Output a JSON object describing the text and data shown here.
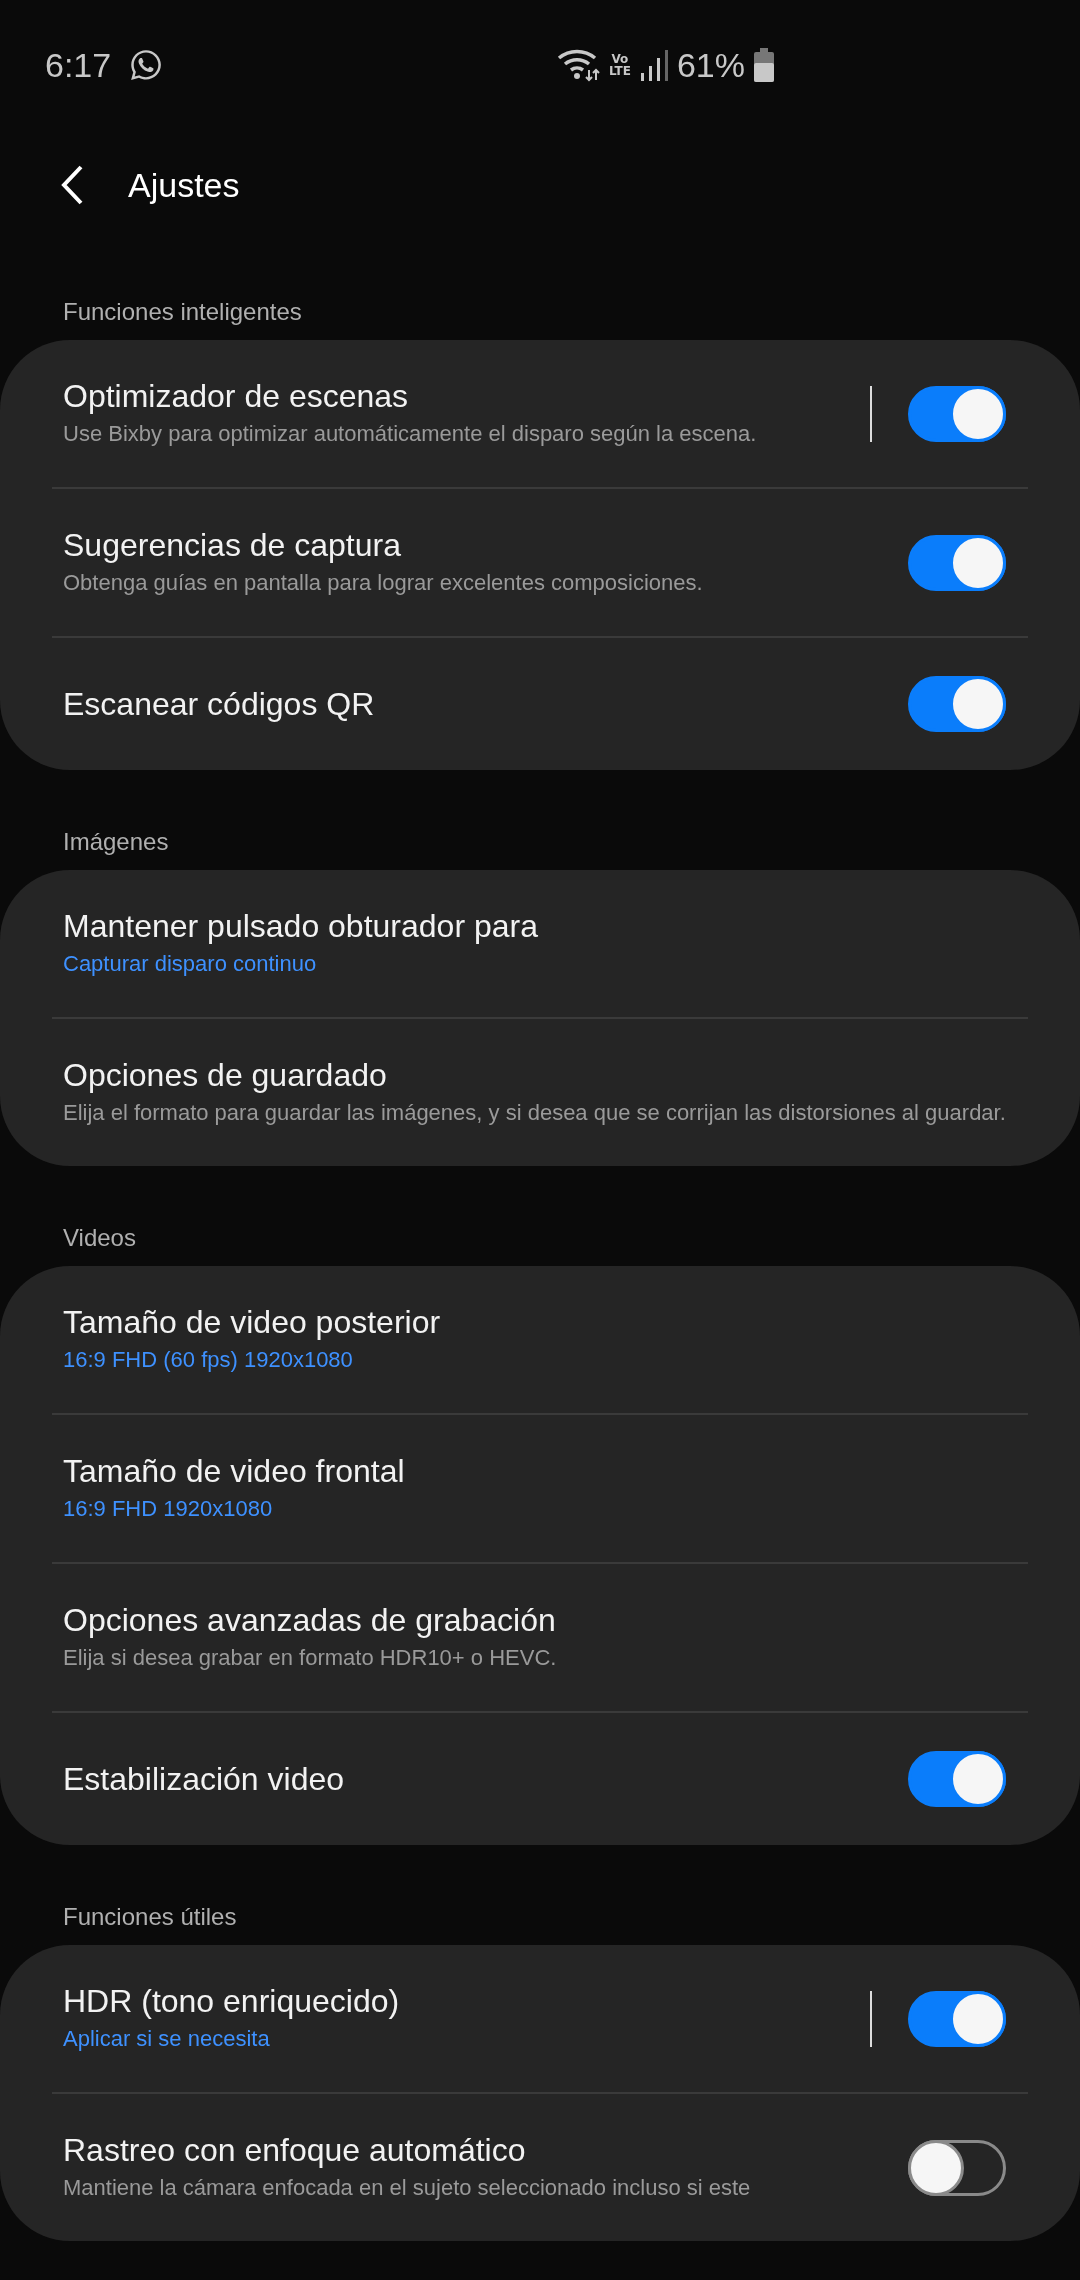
{
  "status_bar": {
    "time": "6:17",
    "network_type": [
      "Vo",
      "LTE"
    ],
    "battery": "61%"
  },
  "header": {
    "title": "Ajustes"
  },
  "sections": [
    {
      "title": "Funciones inteligentes",
      "items": [
        {
          "kind": "switch",
          "title": "Optimizador de escenas",
          "description": "Use Bixby para optimizar automáticamente el disparo según la escena.",
          "on": true,
          "split": true
        },
        {
          "kind": "switch",
          "title": "Sugerencias de captura",
          "description": "Obtenga guías en pantalla para lograr excelentes composiciones.",
          "on": true,
          "split": false
        },
        {
          "kind": "switch",
          "title": "Escanear códigos QR",
          "on": true,
          "split": false
        }
      ]
    },
    {
      "title": "Imágenes",
      "items": [
        {
          "kind": "link",
          "title": "Mantener pulsado obturador para",
          "value": "Capturar disparo continuo"
        },
        {
          "kind": "link",
          "title": "Opciones de guardado",
          "description": "Elija el formato para guardar las imágenes, y si desea que se corrijan las distorsiones al guardar."
        }
      ]
    },
    {
      "title": "Videos",
      "items": [
        {
          "kind": "link",
          "title": "Tamaño de video posterior",
          "value": "16:9 FHD (60 fps) 1920x1080"
        },
        {
          "kind": "link",
          "title": "Tamaño de video frontal",
          "value": "16:9 FHD 1920x1080"
        },
        {
          "kind": "link",
          "title": "Opciones avanzadas de grabación",
          "description": "Elija si desea grabar en formato HDR10+ o HEVC."
        },
        {
          "kind": "switch",
          "title": "Estabilización video",
          "on": true,
          "split": false
        }
      ]
    },
    {
      "title": "Funciones útiles",
      "items": [
        {
          "kind": "switch",
          "title": "HDR (tono enriquecido)",
          "value": "Aplicar si se necesita",
          "on": true,
          "split": true
        },
        {
          "kind": "switch",
          "title": "Rastreo con enfoque automático",
          "description": "Mantiene la cámara enfocada en el sujeto seleccionado incluso si este",
          "on": false,
          "split": false
        }
      ]
    }
  ]
}
